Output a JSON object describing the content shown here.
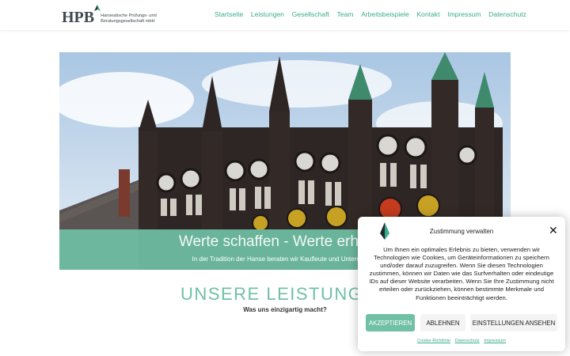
{
  "header": {
    "logo_text": "HPB",
    "logo_sub_line1": "Hanseatische Prüfungs- und",
    "logo_sub_line2": "Beratungsgesellschaft mbH",
    "nav": [
      "Startseite",
      "Leistungen",
      "Gesellschaft",
      "Team",
      "Arbeitsbeispiele",
      "Kontakt",
      "Impressum",
      "Datenschutz"
    ]
  },
  "hero": {
    "title": "Werte schaffen - Werte erhalten",
    "subtitle": "In der Tradition der Hanse beraten wir Kaufleute und Unternehmer"
  },
  "services": {
    "title": "UNSERE LEISTUNGEN",
    "subtitle": "Was uns einzigartig macht?"
  },
  "consent": {
    "title": "Zustimmung verwalten",
    "close": "✕",
    "text": "Um Ihnen ein optimales Erlebnis zu bieten, verwenden wir Technologien wie Cookies, um Geräteinformationen zu speichern und/oder darauf zuzugreifen. Wenn Sie diesen Technologien zustimmen, können wir Daten wie das Surfverhalten oder eindeutige IDs auf dieser Website verarbeiten. Wenn Sie Ihre Zustimmung nicht erteilen oder zurückziehen, können bestimmte Merkmale und Funktionen beeinträchtigt werden.",
    "accept": "Akzeptieren",
    "deny": "Ablehnen",
    "settings": "Einstellungen ansehen",
    "links": [
      "Cookie-Richtlinie",
      "Datenschutz",
      "Impressum"
    ]
  },
  "colors": {
    "accent": "#3aab8c",
    "band": "#6fc0a5",
    "brick": "#2e2624",
    "copper": "#3f8a6c",
    "sky": "#c9daea"
  }
}
